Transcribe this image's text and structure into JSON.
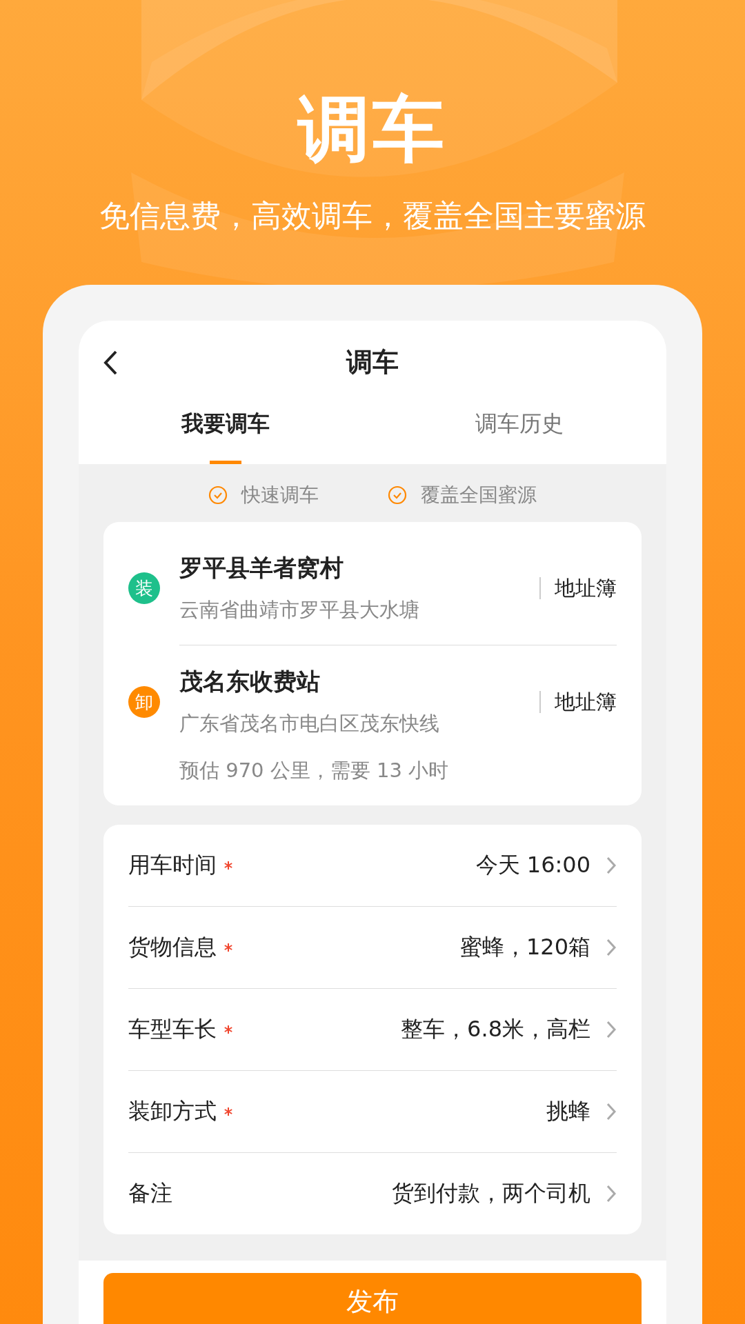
{
  "promo": {
    "title": "调车",
    "subtitle": "免信息费，高效调车，覆盖全国主要蜜源"
  },
  "header": {
    "title": "调车"
  },
  "tabs": [
    {
      "label": "我要调车",
      "selected": true
    },
    {
      "label": "调车历史",
      "selected": false
    }
  ],
  "features": [
    "快速调车",
    "覆盖全国蜜源"
  ],
  "route": {
    "stops": [
      {
        "badge": "装",
        "color": "#1ec08b",
        "name": "罗平县羊者窝村",
        "address": "云南省曲靖市罗平县大水塘",
        "action": "地址簿"
      },
      {
        "badge": "卸",
        "color": "#ff8a00",
        "name": "茂名东收费站",
        "address": "广东省茂名市电白区茂东快线",
        "action": "地址簿"
      }
    ],
    "estimate": "预估 970 公里，需要 13 小时"
  },
  "form": [
    {
      "label": "用车时间",
      "required": true,
      "value": "今天 16:00"
    },
    {
      "label": "货物信息",
      "required": true,
      "value": "蜜蜂，120箱"
    },
    {
      "label": "车型车长",
      "required": true,
      "value": "整车，6.8米，高栏"
    },
    {
      "label": "装卸方式",
      "required": true,
      "value": "挑蜂"
    },
    {
      "label": "备注",
      "required": false,
      "value": "货到付款，两个司机"
    }
  ],
  "submit": {
    "label": "发布"
  }
}
